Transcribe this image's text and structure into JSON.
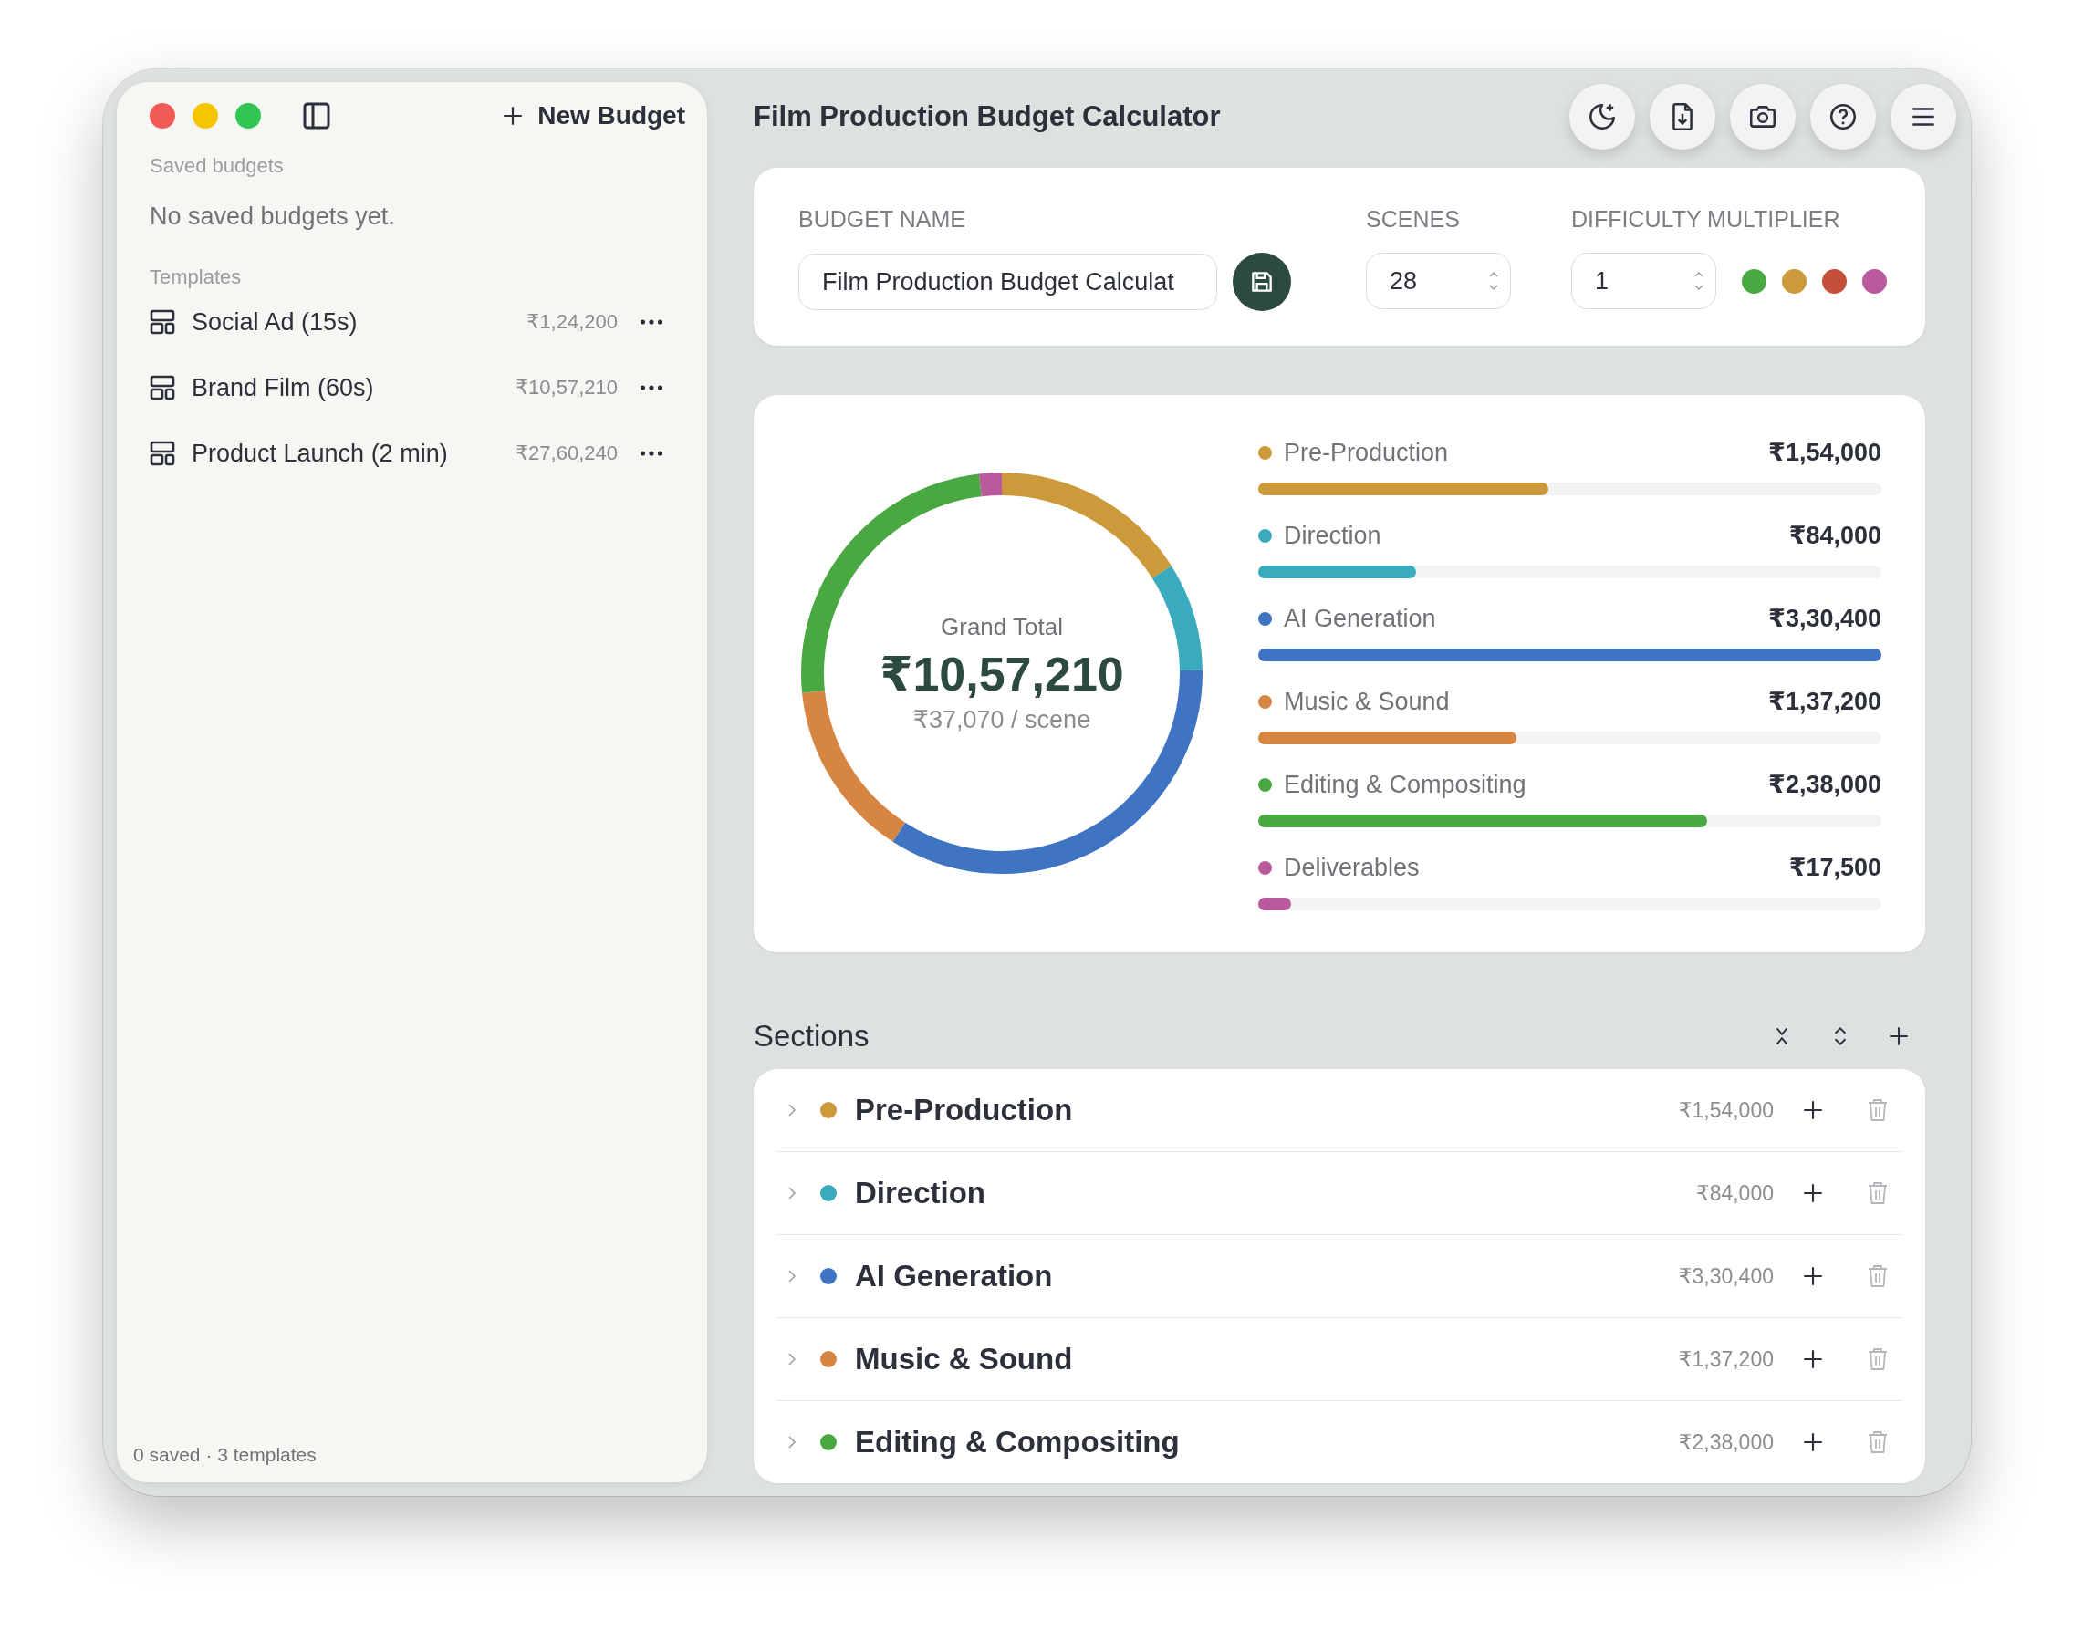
{
  "window": {
    "title": "Film Production Budget Calculator"
  },
  "sidebar": {
    "new_button": "New Budget",
    "saved_heading": "Saved budgets",
    "saved_empty": "No saved budgets yet.",
    "templates_heading": "Templates",
    "templates": [
      {
        "name": "Social Ad (15s)",
        "total": "₹1,24,200"
      },
      {
        "name": "Brand Film (60s)",
        "total": "₹10,57,210"
      },
      {
        "name": "Product Launch (2 min)",
        "total": "₹27,60,240"
      }
    ],
    "footer": "0 saved · 3 templates"
  },
  "settings": {
    "budget_name": {
      "label": "BUDGET NAME",
      "value": "Film Production Budget Calculat"
    },
    "scenes": {
      "label": "SCENES",
      "value": "28"
    },
    "difficulty": {
      "label": "DIFFICULTY MULTIPLIER",
      "value": "1"
    },
    "color_presets": [
      {
        "color": "#4aa843"
      },
      {
        "color": "#cc9a3a"
      },
      {
        "color": "#c4503a"
      },
      {
        "color": "#b85a9c"
      }
    ]
  },
  "summary": {
    "total_label": "Grand Total",
    "total": "₹10,57,210",
    "per_scene": "₹37,070 / scene",
    "chart_data": {
      "type": "donut",
      "categories": [
        "Pre-Production",
        "Direction",
        "AI Generation",
        "Music & Sound",
        "Editing & Compositing",
        "Deliverables"
      ],
      "series": [
        {
          "values": [
            16.02,
            8.74,
            34.38,
            14.28,
            24.76,
            1.82
          ]
        }
      ]
    },
    "breakdown": [
      {
        "amount": "₹1,54,000",
        "color": "#cc9a3a",
        "level": 0.466
      },
      {
        "amount": "₹84,000",
        "color": "#3aabbd",
        "level": 0.254
      },
      {
        "amount": "₹3,30,400",
        "color": "#3f74c2",
        "level": 1
      },
      {
        "amount": "₹1,37,200",
        "color": "#d68642",
        "level": 0.415
      },
      {
        "amount": "₹2,38,000",
        "color": "#4aa843",
        "level": 0.72
      },
      {
        "amount": "₹17,500",
        "color": "#b85a9c",
        "level": 0.053
      }
    ]
  },
  "sections": {
    "title": "Sections",
    "items": [
      {
        "name": "Pre-Production",
        "amount": "₹1,54,000",
        "color": "#cc9a3a",
        "expanded": false
      },
      {
        "name": "Direction",
        "amount": "₹84,000",
        "color": "#3aabbd",
        "expanded": false
      },
      {
        "name": "AI Generation",
        "amount": "₹3,30,400",
        "color": "#3f74c2",
        "expanded": false
      },
      {
        "name": "Music & Sound",
        "amount": "₹1,37,200",
        "color": "#d68642",
        "expanded": false
      },
      {
        "name": "Editing & Compositing",
        "amount": "₹2,38,000",
        "color": "#4aa843",
        "expanded": false
      }
    ]
  }
}
